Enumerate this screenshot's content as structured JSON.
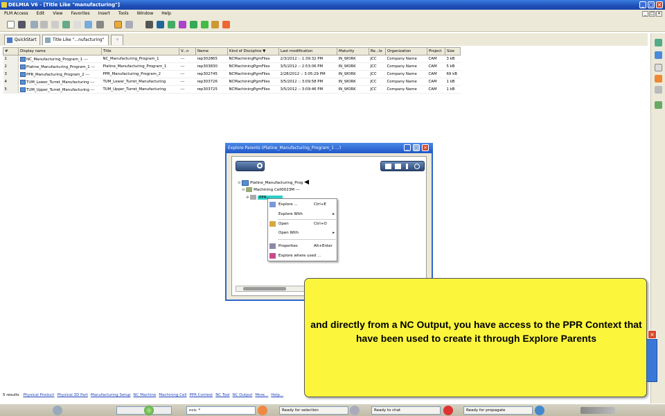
{
  "window": {
    "title": "DELMIA V6 - [Title Like \"manufacturing\"]"
  },
  "menu": [
    "PLM Access",
    "Edit",
    "View",
    "Favorites",
    "Insert",
    "Tools",
    "Window",
    "Help"
  ],
  "tabs": [
    {
      "label": "QuickStart"
    },
    {
      "label": "Title Like \"...nufacturing\""
    },
    {
      "label": "+"
    }
  ],
  "table": {
    "columns": [
      "#",
      "Display name",
      "Title",
      "V...n",
      "Name",
      "Kind of Discipline ▼",
      "Last modification",
      "Maturity",
      "Re...le",
      "Organization",
      "Project",
      "Size"
    ],
    "rows": [
      [
        "1",
        "NC_Manufacturing_Program_1 ---",
        "NC_Manufacturing_Program_1",
        "---",
        "rep302865",
        "NCMachiningPgmFiles",
        "2/3/2012 :: 1:39:32 PM",
        "IN_WORK",
        "JCC",
        "Company Name",
        "CAM",
        "3 kB"
      ],
      [
        "2",
        "Platine_Manufacturing_Program_1 ---",
        "Platine_Manufacturing_Program_1",
        "---",
        "rep303830",
        "NCMachiningPgmFiles",
        "3/5/2012 :: 2:53:06 PM",
        "IN_WORK",
        "JCC",
        "Company Name",
        "CAM",
        "5 kB"
      ],
      [
        "3",
        "PPR_Manufacturing_Program_2 ---",
        "PPR_Manufacturing_Program_2",
        "---",
        "rep302745",
        "NCMachiningPgmFiles",
        "2/28/2012 :: 3:05:29 PM",
        "IN_WORK",
        "JCC",
        "Company Name",
        "CAM",
        "69 kB"
      ],
      [
        "4",
        "TUM_Lower_Turret_Manufacturing ---",
        "TUM_Lower_Turret_Manufacturing",
        "---",
        "rep303726",
        "NCMachiningPgmFiles",
        "3/5/2012 :: 3:09:58 PM",
        "IN_WORK",
        "JCC",
        "Company Name",
        "CAM",
        "1 kB"
      ],
      [
        "5",
        "TUM_Upper_Turret_Manufacturing ---",
        "TUM_Upper_Turret_Manufacturing",
        "---",
        "rep303725",
        "NCMachiningPgmFiles",
        "3/5/2012 :: 3:09:46 PM",
        "IN_WORK",
        "JCC",
        "Company Name",
        "CAM",
        "1 kB"
      ]
    ]
  },
  "dialog": {
    "title": "Explore Parents (Platine_Manufacturing_Program_1 ...)",
    "tree": {
      "root": "Platine_Manufacturing_Prog",
      "child": "Machining Cell0023M ---",
      "selected": "PPR..."
    }
  },
  "context_menu": {
    "items": [
      {
        "label": "Explore ...",
        "shortcut": "Ctrl+E",
        "arrow": ""
      },
      {
        "label": "Explore With",
        "shortcut": "",
        "arrow": "▸"
      },
      {
        "label": "Open",
        "shortcut": "Ctrl+O",
        "arrow": ""
      },
      {
        "label": "Open With",
        "shortcut": "",
        "arrow": "▸"
      },
      {
        "label": "Properties",
        "shortcut": "Alt+Enter",
        "arrow": ""
      },
      {
        "label": "Explore where used ...",
        "shortcut": "",
        "arrow": ""
      }
    ]
  },
  "callout": {
    "text": "and directly from a NC Output, you have access to the PPR Context that have been used to create it through Explore Parents"
  },
  "status_links": {
    "prefix": "5 results",
    "links": [
      "Physical Product",
      "Physical 3D Part",
      "Manufacturing Setup",
      "NC Machine",
      "Machining Cell",
      "PPR Context",
      "NC Tool",
      "NC Output",
      "More...",
      "Help..."
    ]
  },
  "taskbar": {
    "command": "nco: *",
    "status1": "Ready for selection",
    "status2": "Ready to chat",
    "status3": "Ready for propagate"
  },
  "colors": {
    "callout_bg": "#fbf63c",
    "title_bar": "#1f4fb8",
    "link": "#1b3fb8"
  }
}
